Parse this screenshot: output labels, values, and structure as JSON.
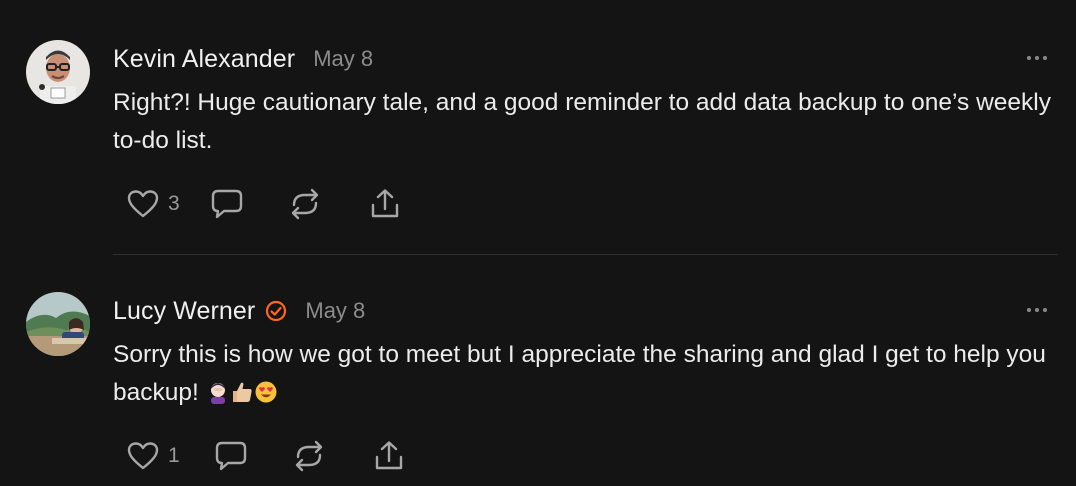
{
  "comments": [
    {
      "author": "Kevin Alexander",
      "date": "May 8",
      "verified": false,
      "body": "Right?! Huge cautionary tale, and a good reminder to add data backup to one’s weekly to-do list.",
      "likes": "3",
      "avatar_icon": "kevin-avatar"
    },
    {
      "author": "Lucy Werner",
      "date": "May 8",
      "verified": true,
      "body": "Sorry this is how we got to meet but I appreciate the sharing and glad I get to help you backup!",
      "emojis": [
        "woman-facepalming-emoji",
        "thumbs-up-emoji",
        "heart-eyes-emoji"
      ],
      "likes": "1",
      "avatar_icon": "lucy-avatar"
    }
  ],
  "icons": {
    "like": "heart-icon",
    "reply": "speech-bubble-icon",
    "restack": "restack-icon",
    "share": "share-icon",
    "more": "ellipsis-icon",
    "verified": "verified-check-icon"
  },
  "colors": {
    "background": "#141414",
    "text": "#ececec",
    "muted": "#8c8c8c",
    "verified": "#ff6719"
  }
}
